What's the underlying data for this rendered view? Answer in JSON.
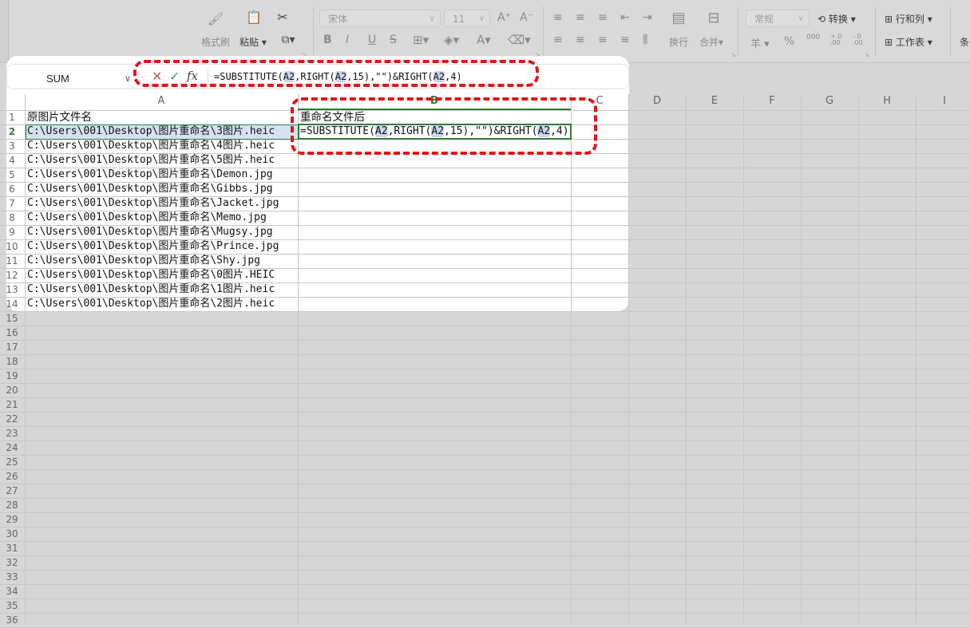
{
  "ribbon": {
    "format_painter": "格式刷",
    "paste": "粘贴",
    "font_name": "宋体",
    "font_size": "11",
    "wrap": "换行",
    "merge": "合并",
    "number_format": "常规",
    "convert": "转换",
    "rows_cols": "行和列",
    "worksheet": "工作表",
    "condition": "条",
    "currency_symbol": "羊",
    "percent_symbol": "%",
    "thousands": "000",
    "dec_inc": "+.0\n.00",
    "dec_dec": "-.0\n.00"
  },
  "formula_bar": {
    "name_box": "SUM",
    "formula": [
      {
        "t": "=SUBSTITUTE(",
        "ref": false
      },
      {
        "t": "A2",
        "ref": true
      },
      {
        "t": ",RIGHT(",
        "ref": false
      },
      {
        "t": "A2",
        "ref": true
      },
      {
        "t": ",15),\"\")&RIGHT(",
        "ref": false
      },
      {
        "t": "A2",
        "ref": true
      },
      {
        "t": ",4)",
        "ref": false
      }
    ]
  },
  "columns": [
    "A",
    "B",
    "C",
    "D",
    "E",
    "F",
    "G",
    "H",
    "I"
  ],
  "rows": [
    "1",
    "2",
    "3",
    "4",
    "5",
    "6",
    "7",
    "8",
    "9",
    "10",
    "11",
    "12",
    "13",
    "14",
    "15",
    "16",
    "17",
    "18",
    "19",
    "20",
    "21",
    "22",
    "23",
    "24",
    "25",
    "26",
    "27",
    "28",
    "29",
    "30",
    "31",
    "32",
    "33",
    "34",
    "35",
    "36"
  ],
  "cells": {
    "A1": "原图片文件名",
    "B1": "重命名文件后",
    "A": [
      "C:\\Users\\001\\Desktop\\图片重命名\\3图片.heic",
      "C:\\Users\\001\\Desktop\\图片重命名\\4图片.heic",
      "C:\\Users\\001\\Desktop\\图片重命名\\5图片.heic",
      "C:\\Users\\001\\Desktop\\图片重命名\\Demon.jpg",
      "C:\\Users\\001\\Desktop\\图片重命名\\Gibbs.jpg",
      "C:\\Users\\001\\Desktop\\图片重命名\\Jacket.jpg",
      "C:\\Users\\001\\Desktop\\图片重命名\\Memo.jpg",
      "C:\\Users\\001\\Desktop\\图片重命名\\Mugsy.jpg",
      "C:\\Users\\001\\Desktop\\图片重命名\\Prince.jpg",
      "C:\\Users\\001\\Desktop\\图片重命名\\Shy.jpg",
      "C:\\Users\\001\\Desktop\\图片重命名\\0图片.HEIC",
      "C:\\Users\\001\\Desktop\\图片重命名\\1图片.heic",
      "C:\\Users\\001\\Desktop\\图片重命名\\2图片.heic"
    ]
  },
  "colors": {
    "highlight": "#e0161b",
    "active_border": "#2f7a3c",
    "ref_bg": "#c9d8ee"
  }
}
